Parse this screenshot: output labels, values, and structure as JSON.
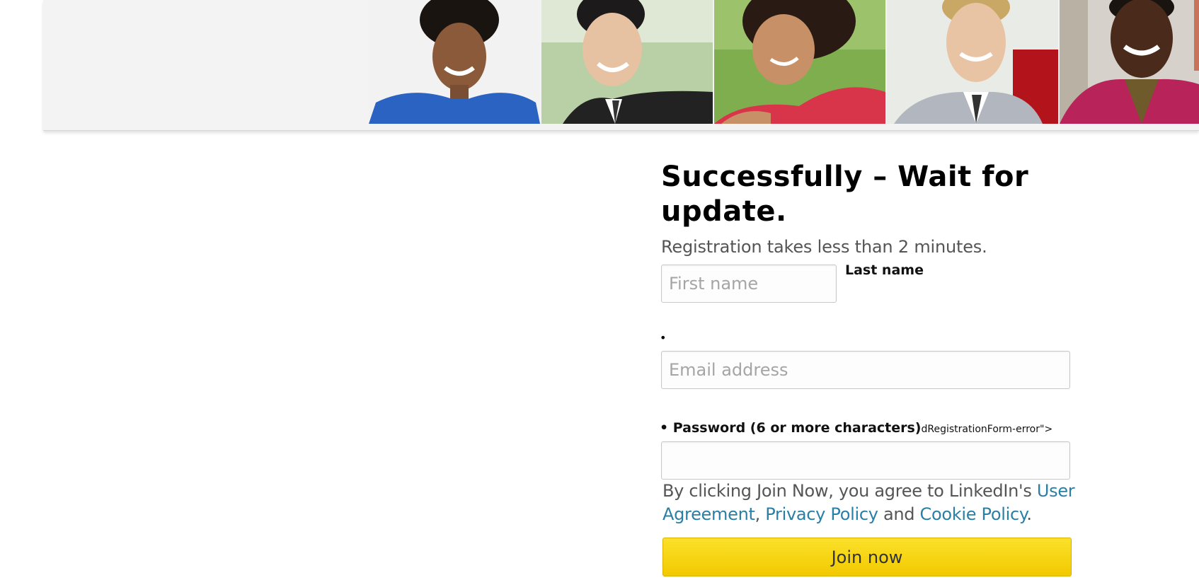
{
  "form": {
    "heading": "Successfully – Wait for update.",
    "subtitle": "Registration takes less than 2 minutes.",
    "first_name_placeholder": "First name",
    "last_name_label": "Last name",
    "bullet": "•",
    "email_placeholder": "Email address",
    "password_label": "• Password (6 or more characters)",
    "password_label_fragment": "dRegistrationForm-error\">",
    "terms": {
      "prefix": "By clicking Join Now, you agree to LinkedIn's ",
      "user_agreement": "User Agreement",
      "comma": ", ",
      "privacy_policy": "Privacy Policy",
      "and": " and ",
      "cookie_policy": "Cookie Policy",
      "period": "."
    },
    "join_button": "Join now"
  },
  "colors": {
    "link": "#2a7fa6",
    "join_button": "#f5d20f",
    "hero_background": "#f3f3f3"
  }
}
